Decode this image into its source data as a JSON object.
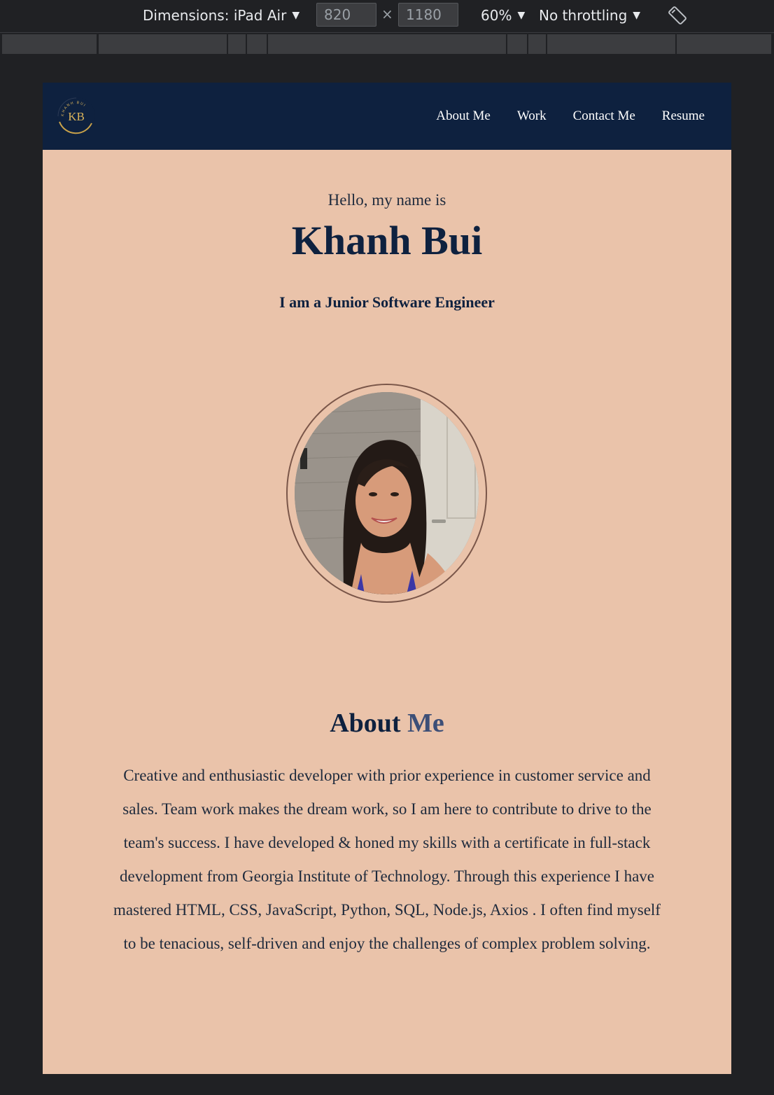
{
  "devtools": {
    "device_label": "Dimensions: iPad Air",
    "width_value": "820",
    "height_value": "1180",
    "times_symbol": "×",
    "zoom_label": "60%",
    "throttle_label": "No throttling",
    "caret": "▼",
    "rotate_icon": "rotate-icon"
  },
  "site": {
    "logo": {
      "icon": "kb-logo-icon",
      "arc_text": "KHANH BUI",
      "initials": "KB"
    },
    "nav": {
      "about": "About Me",
      "work": "Work",
      "contact": "Contact Me",
      "resume": "Resume"
    },
    "hero": {
      "greeting": "Hello, my name is",
      "name": "Khanh Bui",
      "role": "I am a Junior Software Engineer"
    },
    "about": {
      "title_main": "About ",
      "title_accent": "Me",
      "body": "Creative and enthusiastic developer with prior experience in customer service and sales. Team work makes the dream work, so I am here to contribute to drive to the team's success. I have developed & honed my skills with a certificate in full-stack development from Georgia Institute of Technology. Through this experience I have mastered HTML, CSS, JavaScript, Python, SQL, Node.js, Axios . I often find myself to be tenacious, self-driven and enjoy the challenges of complex problem solving."
    }
  },
  "colors": {
    "navbar_bg": "#0e213f",
    "page_bg": "#eac3aa",
    "accent": "#3d4f77",
    "photo_border": "#7a5649"
  }
}
